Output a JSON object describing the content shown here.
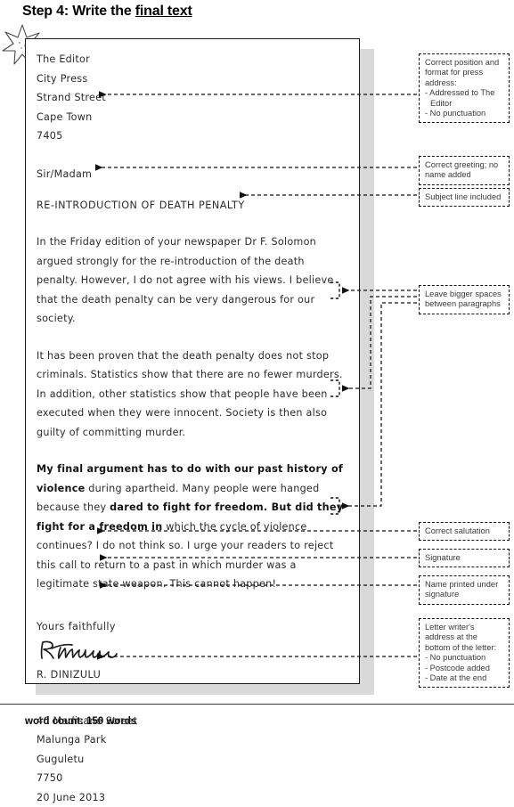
{
  "header": {
    "title_plain": "Step 4: Write the ",
    "title_underlined": "final text"
  },
  "letter": {
    "recipient_address": [
      "The Editor",
      "City Press",
      "Strand Street",
      "Cape Town",
      "7405"
    ],
    "greeting": "Sir/Madam",
    "subject": "RE-INTRODUCTION OF DEATH PENALTY",
    "paragraph_1": "In the Friday edition of your newspaper Dr F. Solomon argued strongly for the re-introduction of the death penalty. However, I do not agree with his views. I believe that the death penalty can be very dangerous for our society.",
    "paragraph_2": "It has been proven that the death penalty does not stop criminals. Statistics show that there are no fewer murders. In addition, other statistics show that people have been executed when they were innocent. Society is then also guilty of committing murder.",
    "paragraph_3_a": "My final argument has to do with our past history of violence",
    "paragraph_3_b": " during apartheid. Many people were hanged because they ",
    "paragraph_3_c": "dared to fight for freedom. But did they fight for a freedom in",
    "paragraph_3_d": " which the cycle of violence continues? I do not think so. I urge your readers to reject this call to return to a past in which murder was a legitimate state weapon. This cannot happen!",
    "salutation": "Yours faithfully",
    "signature_text": "R.Dinzulu",
    "printed_name": "R. DINIZULU",
    "sender_address": [
      "46 Madisane Street",
      "Malunga Park",
      "Guguletu",
      "7750",
      "20 June 2013"
    ]
  },
  "annotations": {
    "press_address": [
      "Correct position and",
      "format for press",
      "address:",
      "- Addressed to The",
      "Editor",
      "- No punctuation"
    ],
    "greeting": [
      "Correct greeting; no",
      "name added"
    ],
    "subject": [
      "Subject line included"
    ],
    "spacing": [
      "Leave bigger spaces",
      "between paragraphs"
    ],
    "salutation": [
      "Correct salutation"
    ],
    "signature": [
      "Signature"
    ],
    "printed_name": [
      "Name printed under",
      "signature"
    ],
    "writer_address": [
      "Letter writer's",
      "address at the",
      "bottom of the letter:",
      "- No punctuation",
      "- Postcode added",
      "- Date at the end"
    ]
  },
  "footer": {
    "word_count": "word count: 150 words"
  },
  "colors": {
    "ink": "#2b2b2b",
    "rule": "#3c3c3c",
    "shadow": "#d9d9d9",
    "annotation_text": "#3a3a3a"
  }
}
